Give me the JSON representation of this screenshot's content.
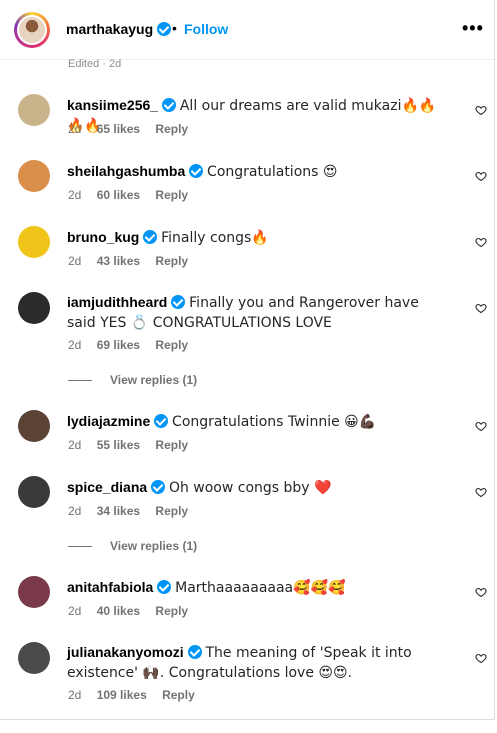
{
  "post": {
    "username": "marthakayug",
    "follow_label": "Follow",
    "separator": "•",
    "more_label": "•••",
    "edited_label": "Edited · 2d"
  },
  "comments": [
    {
      "username": "kansiime256_",
      "text": "All our dreams are valid mukazi🔥🔥🔥🔥",
      "age": "2d",
      "likes": "65 likes",
      "reply": "Reply",
      "avatar_color": "#c9b38a"
    },
    {
      "username": "sheilahgashumba",
      "text": "Congratulations 😍",
      "age": "2d",
      "likes": "60 likes",
      "reply": "Reply",
      "avatar_color": "#d98e4a"
    },
    {
      "username": "bruno_kug",
      "text": "Finally congs🔥",
      "age": "2d",
      "likes": "43 likes",
      "reply": "Reply",
      "avatar_color": "#f0c419"
    },
    {
      "username": "iamjudithheard",
      "text": "Finally you and Rangerover have said YES 💍 CONGRATULATIONS LOVE",
      "age": "2d",
      "likes": "69 likes",
      "reply": "Reply",
      "avatar_color": "#2b2b2b"
    },
    {
      "username": "lydiajazmine",
      "text": "Congratulations Twinnie 😀💪🏿",
      "age": "2d",
      "likes": "55 likes",
      "reply": "Reply",
      "avatar_color": "#5a4234"
    },
    {
      "username": "spice_diana",
      "text": "Oh woow congs bby ❤️",
      "age": "2d",
      "likes": "34 likes",
      "reply": "Reply",
      "avatar_color": "#3a3a3a"
    },
    {
      "username": "anitahfabiola",
      "text": "Marthaaaaaaaaa🥰🥰🥰",
      "age": "2d",
      "likes": "40 likes",
      "reply": "Reply",
      "avatar_color": "#7a3a4a"
    },
    {
      "username": "julianakanyomozi",
      "text": "The meaning of 'Speak it into existence' 🙌🏿. Congratulations love 😍😍.",
      "age": "2d",
      "likes": "109 likes",
      "reply": "Reply",
      "avatar_color": "#4a4a4a"
    }
  ],
  "view_replies": [
    {
      "label": "View replies (1)"
    },
    {
      "label": "View replies (1)"
    }
  ]
}
